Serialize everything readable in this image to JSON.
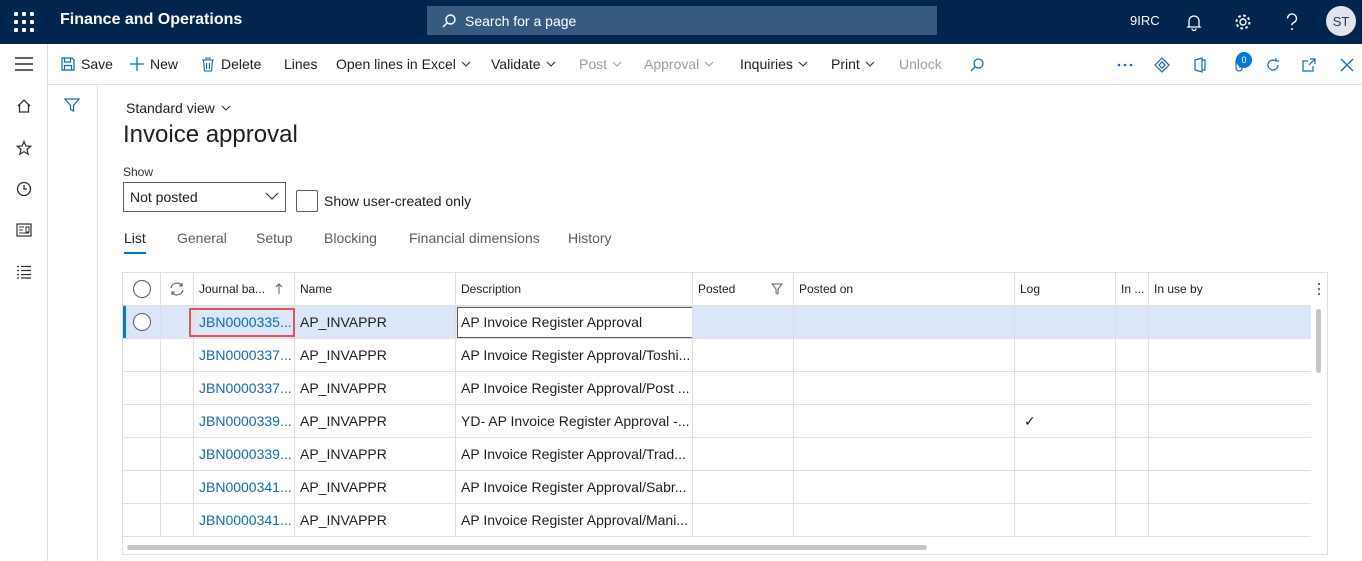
{
  "header": {
    "app_title": "Finance and Operations",
    "search_placeholder": "Search for a page",
    "company": "9IRC",
    "avatar_initials": "ST",
    "notification_badge": "0"
  },
  "actions": {
    "save": "Save",
    "new": "New",
    "delete": "Delete",
    "lines": "Lines",
    "open_in_excel": "Open lines in Excel",
    "validate": "Validate",
    "post": "Post",
    "approval": "Approval",
    "inquiries": "Inquiries",
    "print": "Print",
    "unlock": "Unlock"
  },
  "page": {
    "view_name": "Standard view",
    "title": "Invoice approval",
    "show_label": "Show",
    "show_value": "Not posted",
    "user_created_label": "Show user-created only"
  },
  "tabs": [
    "List",
    "General",
    "Setup",
    "Blocking",
    "Financial dimensions",
    "History"
  ],
  "grid": {
    "columns": [
      "Journal ba...",
      "Name",
      "Description",
      "Posted",
      "Posted on",
      "Log",
      "In ...",
      "In use by"
    ],
    "rows": [
      {
        "batch": "JBN0000335...",
        "name": "AP_INVAPPR",
        "description": "AP Invoice Register Approval",
        "log": ""
      },
      {
        "batch": "JBN0000337...",
        "name": "AP_INVAPPR",
        "description": "AP Invoice Register Approval/Toshi...",
        "log": ""
      },
      {
        "batch": "JBN0000337...",
        "name": "AP_INVAPPR",
        "description": "AP Invoice Register Approval/Post ...",
        "log": ""
      },
      {
        "batch": "JBN0000339...",
        "name": "AP_INVAPPR",
        "description": "YD- AP Invoice Register Approval -...",
        "log": "✓"
      },
      {
        "batch": "JBN0000339...",
        "name": "AP_INVAPPR",
        "description": "AP Invoice Register Approval/Trad...",
        "log": ""
      },
      {
        "batch": "JBN0000341...",
        "name": "AP_INVAPPR",
        "description": "AP Invoice Register Approval/Sabr...",
        "log": ""
      },
      {
        "batch": "JBN0000341...",
        "name": "AP_INVAPPR",
        "description": "AP Invoice Register Approval/Mani...",
        "log": ""
      }
    ]
  }
}
